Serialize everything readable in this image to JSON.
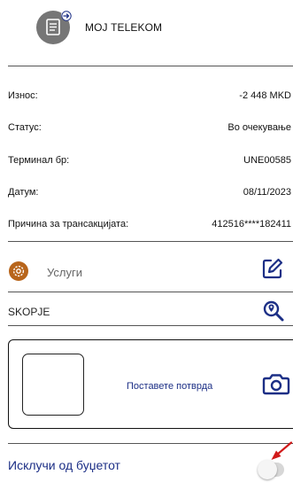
{
  "merchant": {
    "name": "МОЈ TELEKOM",
    "icon": "receipt-icon"
  },
  "details": [
    {
      "label": "Износ:",
      "value": "-2 448 MKD"
    },
    {
      "label": "Статус:",
      "value": "Во очекување"
    },
    {
      "label": "Терминал бр:",
      "value": "UNE00585"
    },
    {
      "label": "Датум:",
      "value": "08/11/2023"
    },
    {
      "label": "Причина за трансакцијата:",
      "value": "412516****182411"
    }
  ],
  "category": {
    "label": "Услуги",
    "icon": "gear-icon",
    "edit_icon": "edit-icon"
  },
  "location": {
    "city": "SKOPJE",
    "icon": "map-search-icon"
  },
  "receipt": {
    "label": "Поставете потврда",
    "icon": "camera-icon"
  },
  "budget": {
    "label": "Исклучи од буџетот",
    "toggle_on": false
  },
  "colors": {
    "accent_blue": "#1c2f86",
    "category_orange": "#b8651b",
    "annotation_red": "#d11a1a"
  }
}
